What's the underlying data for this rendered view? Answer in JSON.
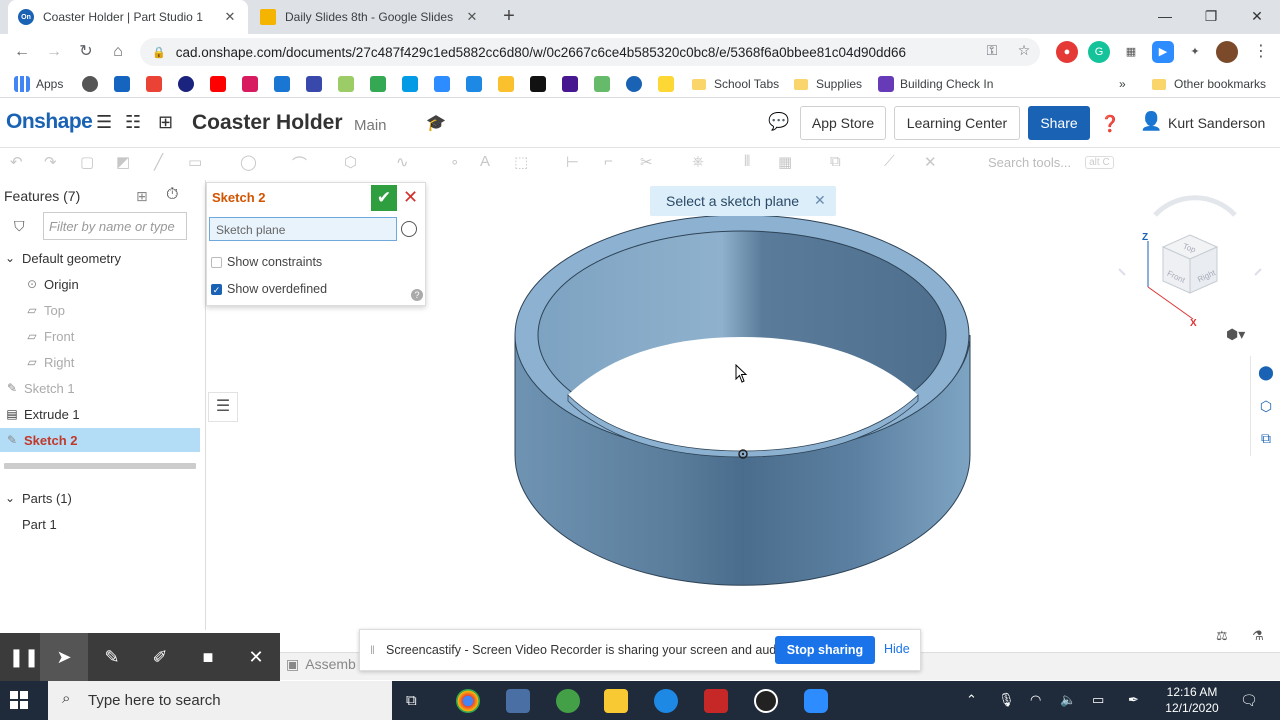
{
  "browser": {
    "tabs": [
      {
        "label": "Coaster Holder | Part Studio 1",
        "favicon": "onshape-icon",
        "active": true
      },
      {
        "label": "Daily Slides 8th - Google Slides",
        "favicon": "slides-icon",
        "active": false
      }
    ],
    "url": "cad.onshape.com/documents/27c487f429c1ed5882cc6d80/w/0c2667c6ce4b585320c0bc8/e/5368f6a0bbee81c04d90dd66",
    "bookmarks": {
      "apps": "Apps",
      "school_tabs": "School Tabs",
      "supplies": "Supplies",
      "building_check_in": "Building Check In",
      "overflow": "»",
      "other": "Other bookmarks"
    }
  },
  "header": {
    "logo": "Onshape",
    "doc_title": "Coaster Holder",
    "branch": "Main",
    "app_store": "App Store",
    "learning_center": "Learning Center",
    "share": "Share",
    "user": "Kurt Sanderson"
  },
  "toolbar": {
    "search_placeholder": "Search tools...",
    "search_shortcut": "alt C"
  },
  "features": {
    "header": "Features (7)",
    "filter_placeholder": "Filter by name or type",
    "items": {
      "default_geometry": "Default geometry",
      "origin": "Origin",
      "top": "Top",
      "front": "Front",
      "right": "Right",
      "sketch1": "Sketch 1",
      "extrude1": "Extrude 1",
      "sketch2": "Sketch 2"
    },
    "parts_header": "Parts (1)",
    "part1": "Part 1"
  },
  "sketch_dialog": {
    "title": "Sketch 2",
    "plane_placeholder": "Sketch plane",
    "show_constraints": "Show constraints",
    "show_overdefined": "Show overdefined",
    "show_constraints_checked": false,
    "show_overdefined_checked": true
  },
  "viewport": {
    "toast": "Select a sketch plane",
    "viewcube": {
      "top": "Top",
      "front": "Front",
      "right": "Right",
      "z": "Z",
      "x": "X"
    },
    "model_color": "#7aa3c4"
  },
  "bottom": {
    "assembly_tab": "Assemb"
  },
  "screencastify": {
    "message": "Screencastify - Screen Video Recorder is sharing your screen and audio.",
    "stop": "Stop sharing",
    "hide": "Hide"
  },
  "taskbar": {
    "search_placeholder": "Type here to search",
    "time": "12:16 AM",
    "date": "12/1/2020"
  },
  "colors": {
    "onshape_blue": "#1a62b4",
    "selection": "#b3dcf6",
    "sketch_orange": "#d35400"
  }
}
